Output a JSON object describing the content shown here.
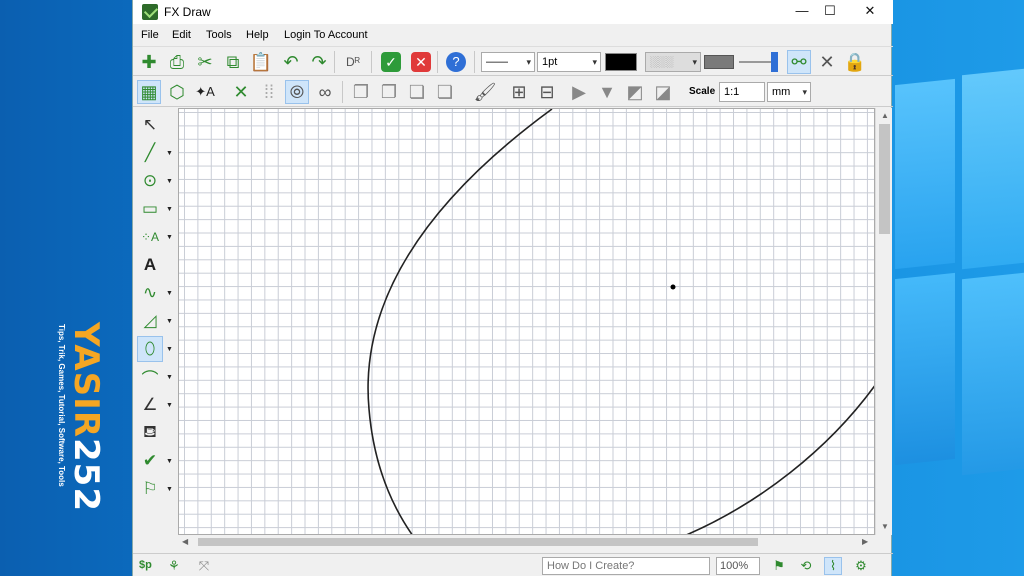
{
  "window": {
    "title": "FX Draw",
    "min": "—",
    "max": "☐",
    "close": "✕"
  },
  "menu": [
    "File",
    "Edit",
    "Tools",
    "Help",
    "Login To Account"
  ],
  "toolbar1": {
    "line_style": "——",
    "line_width": "1pt",
    "buttons": [
      "new-icon",
      "print-icon",
      "cut-icon",
      "copy-icon",
      "paste-icon",
      "undo-icon",
      "redo-icon",
      "dr-icon",
      "ok-icon",
      "cancel-icon",
      "help-icon",
      "pattern-icon",
      "fill-color-icon",
      "slider-icon",
      "link-icon",
      "tools-icon",
      "lock-icon"
    ]
  },
  "toolbar2": {
    "scale_label": "Scale",
    "scale_value": "1:1",
    "units": "mm"
  },
  "statusbar": {
    "sp_label": "$p",
    "help_placeholder": "How Do I Create?",
    "zoom": "100%"
  },
  "watermark": {
    "brand_a": "YASIR",
    "brand_b": "252",
    "tagline": "Tips, Trik, Games, Tutorial, Software, Tools"
  },
  "colors": {
    "accent": "#2f8a2f",
    "selection": "#cfe5fa",
    "grid": "#c9cdd6"
  }
}
